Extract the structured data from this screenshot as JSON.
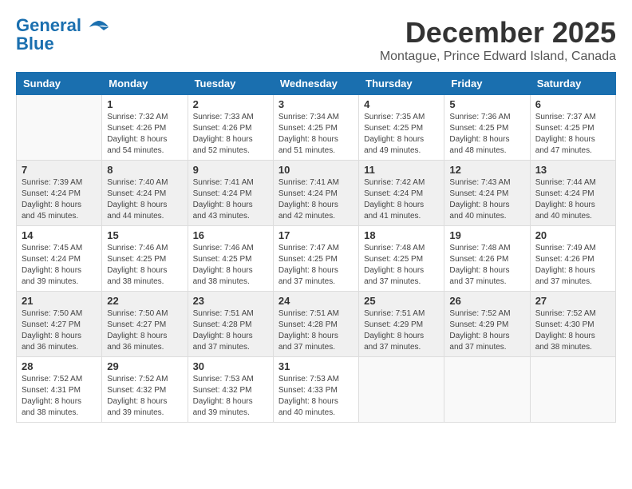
{
  "header": {
    "logo_line1": "General",
    "logo_line2": "Blue",
    "month": "December 2025",
    "location": "Montague, Prince Edward Island, Canada"
  },
  "weekdays": [
    "Sunday",
    "Monday",
    "Tuesday",
    "Wednesday",
    "Thursday",
    "Friday",
    "Saturday"
  ],
  "weeks": [
    [
      {
        "day": "",
        "info": ""
      },
      {
        "day": "1",
        "info": "Sunrise: 7:32 AM\nSunset: 4:26 PM\nDaylight: 8 hours\nand 54 minutes."
      },
      {
        "day": "2",
        "info": "Sunrise: 7:33 AM\nSunset: 4:26 PM\nDaylight: 8 hours\nand 52 minutes."
      },
      {
        "day": "3",
        "info": "Sunrise: 7:34 AM\nSunset: 4:25 PM\nDaylight: 8 hours\nand 51 minutes."
      },
      {
        "day": "4",
        "info": "Sunrise: 7:35 AM\nSunset: 4:25 PM\nDaylight: 8 hours\nand 49 minutes."
      },
      {
        "day": "5",
        "info": "Sunrise: 7:36 AM\nSunset: 4:25 PM\nDaylight: 8 hours\nand 48 minutes."
      },
      {
        "day": "6",
        "info": "Sunrise: 7:37 AM\nSunset: 4:25 PM\nDaylight: 8 hours\nand 47 minutes."
      }
    ],
    [
      {
        "day": "7",
        "info": "Sunrise: 7:39 AM\nSunset: 4:24 PM\nDaylight: 8 hours\nand 45 minutes."
      },
      {
        "day": "8",
        "info": "Sunrise: 7:40 AM\nSunset: 4:24 PM\nDaylight: 8 hours\nand 44 minutes."
      },
      {
        "day": "9",
        "info": "Sunrise: 7:41 AM\nSunset: 4:24 PM\nDaylight: 8 hours\nand 43 minutes."
      },
      {
        "day": "10",
        "info": "Sunrise: 7:41 AM\nSunset: 4:24 PM\nDaylight: 8 hours\nand 42 minutes."
      },
      {
        "day": "11",
        "info": "Sunrise: 7:42 AM\nSunset: 4:24 PM\nDaylight: 8 hours\nand 41 minutes."
      },
      {
        "day": "12",
        "info": "Sunrise: 7:43 AM\nSunset: 4:24 PM\nDaylight: 8 hours\nand 40 minutes."
      },
      {
        "day": "13",
        "info": "Sunrise: 7:44 AM\nSunset: 4:24 PM\nDaylight: 8 hours\nand 40 minutes."
      }
    ],
    [
      {
        "day": "14",
        "info": "Sunrise: 7:45 AM\nSunset: 4:24 PM\nDaylight: 8 hours\nand 39 minutes."
      },
      {
        "day": "15",
        "info": "Sunrise: 7:46 AM\nSunset: 4:25 PM\nDaylight: 8 hours\nand 38 minutes."
      },
      {
        "day": "16",
        "info": "Sunrise: 7:46 AM\nSunset: 4:25 PM\nDaylight: 8 hours\nand 38 minutes."
      },
      {
        "day": "17",
        "info": "Sunrise: 7:47 AM\nSunset: 4:25 PM\nDaylight: 8 hours\nand 37 minutes."
      },
      {
        "day": "18",
        "info": "Sunrise: 7:48 AM\nSunset: 4:25 PM\nDaylight: 8 hours\nand 37 minutes."
      },
      {
        "day": "19",
        "info": "Sunrise: 7:48 AM\nSunset: 4:26 PM\nDaylight: 8 hours\nand 37 minutes."
      },
      {
        "day": "20",
        "info": "Sunrise: 7:49 AM\nSunset: 4:26 PM\nDaylight: 8 hours\nand 37 minutes."
      }
    ],
    [
      {
        "day": "21",
        "info": "Sunrise: 7:50 AM\nSunset: 4:27 PM\nDaylight: 8 hours\nand 36 minutes."
      },
      {
        "day": "22",
        "info": "Sunrise: 7:50 AM\nSunset: 4:27 PM\nDaylight: 8 hours\nand 36 minutes."
      },
      {
        "day": "23",
        "info": "Sunrise: 7:51 AM\nSunset: 4:28 PM\nDaylight: 8 hours\nand 37 minutes."
      },
      {
        "day": "24",
        "info": "Sunrise: 7:51 AM\nSunset: 4:28 PM\nDaylight: 8 hours\nand 37 minutes."
      },
      {
        "day": "25",
        "info": "Sunrise: 7:51 AM\nSunset: 4:29 PM\nDaylight: 8 hours\nand 37 minutes."
      },
      {
        "day": "26",
        "info": "Sunrise: 7:52 AM\nSunset: 4:29 PM\nDaylight: 8 hours\nand 37 minutes."
      },
      {
        "day": "27",
        "info": "Sunrise: 7:52 AM\nSunset: 4:30 PM\nDaylight: 8 hours\nand 38 minutes."
      }
    ],
    [
      {
        "day": "28",
        "info": "Sunrise: 7:52 AM\nSunset: 4:31 PM\nDaylight: 8 hours\nand 38 minutes."
      },
      {
        "day": "29",
        "info": "Sunrise: 7:52 AM\nSunset: 4:32 PM\nDaylight: 8 hours\nand 39 minutes."
      },
      {
        "day": "30",
        "info": "Sunrise: 7:53 AM\nSunset: 4:32 PM\nDaylight: 8 hours\nand 39 minutes."
      },
      {
        "day": "31",
        "info": "Sunrise: 7:53 AM\nSunset: 4:33 PM\nDaylight: 8 hours\nand 40 minutes."
      },
      {
        "day": "",
        "info": ""
      },
      {
        "day": "",
        "info": ""
      },
      {
        "day": "",
        "info": ""
      }
    ]
  ]
}
